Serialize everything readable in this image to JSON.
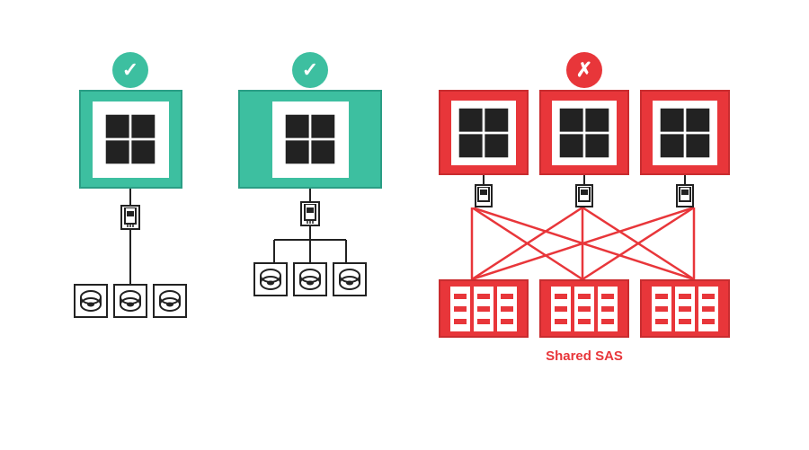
{
  "diagrams": {
    "scenario1": {
      "status": "good",
      "status_symbol": "✓",
      "status_color": "#3dbfa0",
      "server_color": "#3dbfa0",
      "label": ""
    },
    "scenario2": {
      "status": "good",
      "status_symbol": "✓",
      "status_color": "#3dbfa0",
      "server_color": "#3dbfa0",
      "label": ""
    },
    "scenario3": {
      "status": "bad",
      "status_symbol": "✗",
      "status_color": "#e8363a",
      "server_color": "#e8363a",
      "shared_sas_label": "Shared SAS"
    }
  }
}
